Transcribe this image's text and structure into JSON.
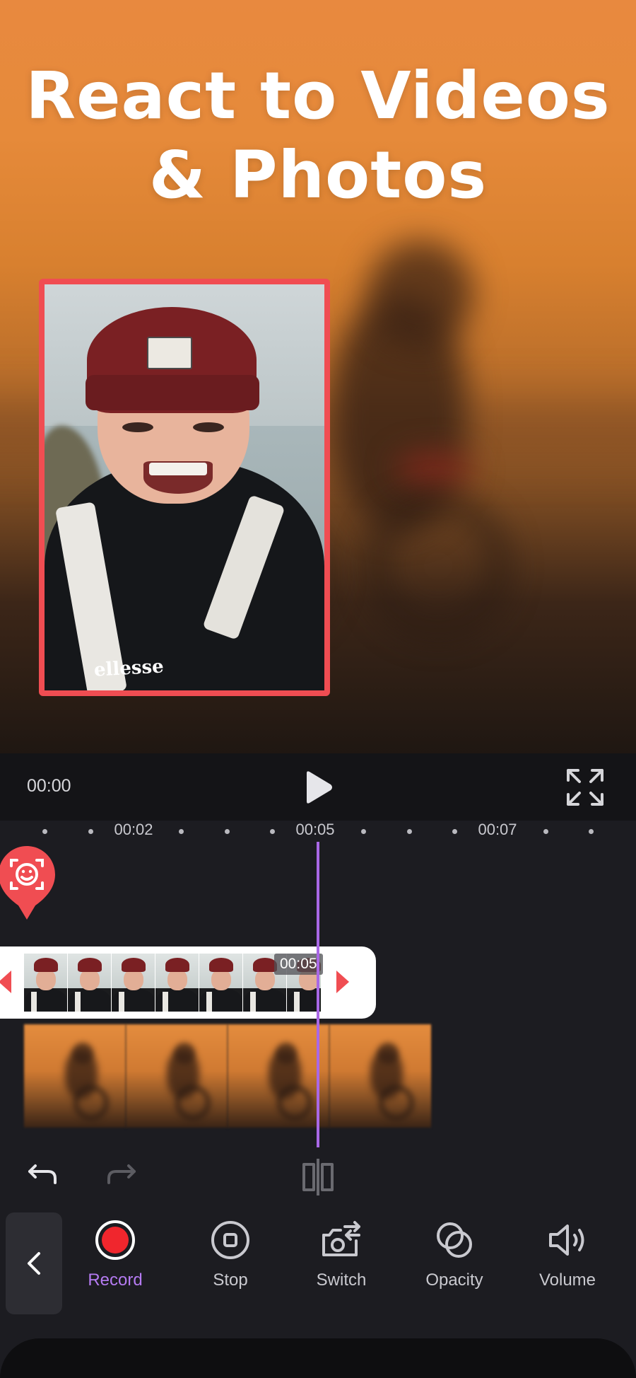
{
  "hero": {
    "title_line1": "React to Videos",
    "title_line2": "& Photos",
    "reaction_brand_text": "ellesse"
  },
  "playback": {
    "current_time": "00:00"
  },
  "timeline": {
    "tick_labels": [
      "00:02",
      "00:05",
      "00:07"
    ],
    "clip_time_badge": "00:05"
  },
  "toolbar": {
    "tools": [
      {
        "label": "Record",
        "icon": "record-icon",
        "active": true
      },
      {
        "label": "Stop",
        "icon": "stop-icon"
      },
      {
        "label": "Switch",
        "icon": "switch-camera-icon"
      },
      {
        "label": "Opacity",
        "icon": "opacity-icon"
      },
      {
        "label": "Volume",
        "icon": "volume-icon"
      }
    ]
  },
  "colors": {
    "accent_purple": "#b57bf2",
    "playhead": "#a968e6",
    "reaction_red": "#f04d52",
    "record_red": "#f0262d",
    "panel_bg": "#1c1c21"
  }
}
